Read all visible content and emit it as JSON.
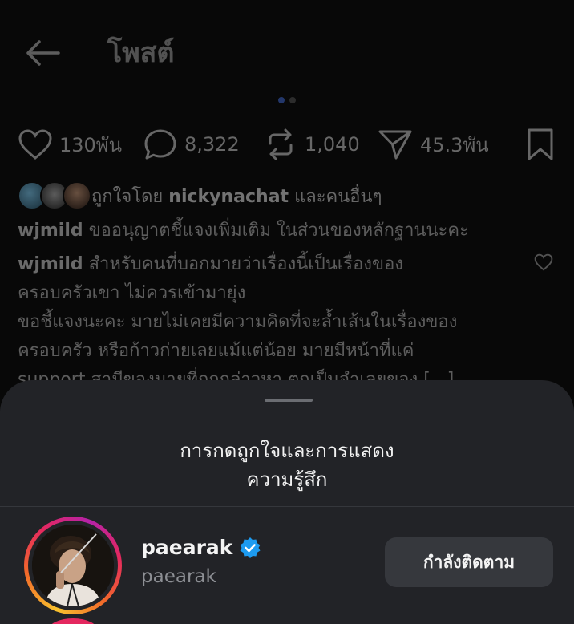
{
  "header": {
    "title": "โพสต์"
  },
  "carousel": {
    "total": 2,
    "active": 0
  },
  "actions": {
    "likes": "130พัน",
    "comments": "8,322",
    "reposts": "1,040",
    "shares": "45.3พัน"
  },
  "liked_by": {
    "prefix": "ถูกใจโดย",
    "user": "nickynachat",
    "suffix": "และคนอื่นๆ"
  },
  "captions": [
    {
      "user": "wjmild",
      "text": "ขออนุญาตชี้แจงเพิ่มเติม ในส่วนของหลักฐานนะคะ"
    },
    {
      "user": "wjmild",
      "text": "สำหรับคนที่บอกมายว่าเรื่องนี้เป็นเรื่องของ",
      "lines": [
        "ครอบครัวเขา ไม่ควรเข้ามายุ่ง",
        "ขอชี้แจงนะคะ มายไม่เคยมีความคิดที่จะล้ำเส้นในเรื่องของ",
        "ครอบครัว หรือก้าวก่ายเลยแม้แต่น้อย มายมีหน้าที่แค่",
        "support สามีของมายที่ถูกกล่าวหา ตกเป็นจำเลยของ [...]"
      ]
    }
  ],
  "sheet": {
    "title_line1": "การกดถูกใจและการแสดง",
    "title_line2": "ความรู้สึก",
    "users": [
      {
        "name": "paearak",
        "handle": "paearak",
        "verified": true,
        "button": "กำลังติดตาม"
      }
    ]
  },
  "colors": {
    "verified": "#1d9bf0",
    "sheet_bg": "#222327",
    "button_bg": "#36383d"
  }
}
